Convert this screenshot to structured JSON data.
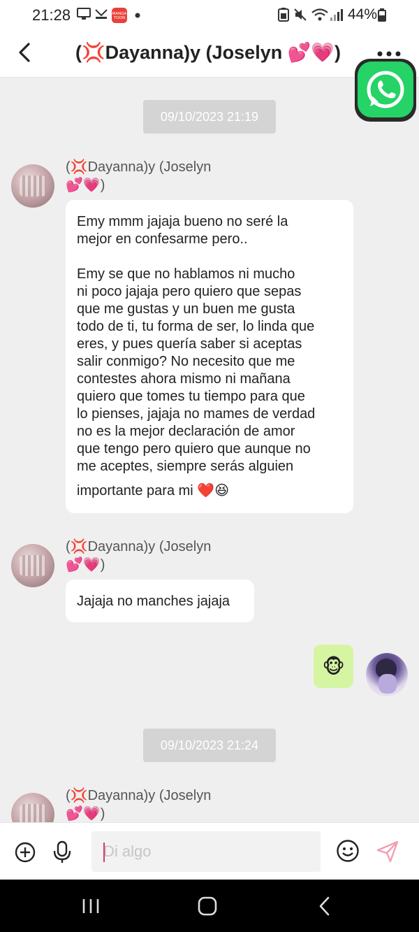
{
  "status_bar": {
    "time": "21:28",
    "battery": "44%"
  },
  "header": {
    "title": "(💢Dayanna)y (Joselyn 💕💗)"
  },
  "chat": {
    "date_1": "09/10/2023 21:19",
    "date_2": "09/10/2023 21:24",
    "messages": [
      {
        "sender": "(💢Dayanna)y (Joselyn\n💕💗)",
        "text": "Emy mmm jajaja bueno no seré la\nmejor en confesarme pero..\n\nEmy se que no hablamos ni mucho\nni poco jajaja pero quiero que sepas\nque me gustas y un buen me gusta\ntodo de ti, tu forma de ser, lo linda que\neres, y pues quería saber si aceptas\nsalir conmigo? No necesito que me\ncontestes ahora mismo ni mañana\nquiero que tomes tu tiempo para que\nlo pienses, jajaja no mames de verdad\nno es la mejor declaración de amor\nque tengo pero quiero que aunque no\nme aceptes, siempre serás alguien",
        "last_line": "importante para mi ❤️😆"
      },
      {
        "sender": "(💢Dayanna)y (Joselyn\n💕💗)",
        "text": "Jajaja no manches jajaja"
      },
      {
        "sender": "(💢Dayanna)y (Joselyn\n💕💗)"
      }
    ],
    "my_sticker": "🐵"
  },
  "input": {
    "placeholder": "Di algo"
  },
  "colors": {
    "background": "#efefef",
    "date_chip": "#d4d4d4",
    "sticker_bubble": "#d6f5a3",
    "whatsapp_green": "#25d366",
    "send_accent": "#f0a0b0",
    "caret": "#e0336f"
  },
  "icons": [
    "back-arrow-icon",
    "more-icon",
    "whatsapp-icon",
    "add-circle-icon",
    "microphone-icon",
    "emoji-icon",
    "send-icon",
    "recents-icon",
    "home-icon",
    "nav-back-icon"
  ]
}
